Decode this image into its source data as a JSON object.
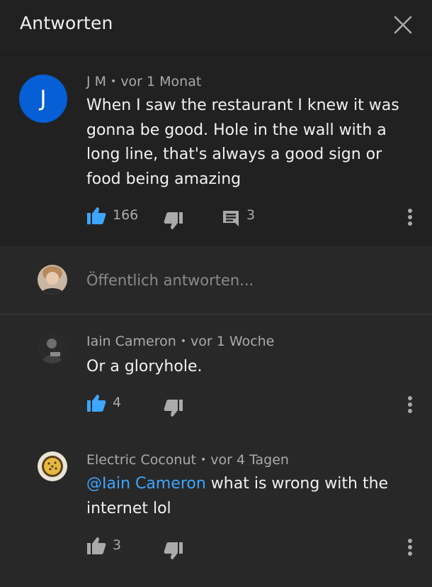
{
  "header": {
    "title": "Antworten",
    "close_icon": "close-icon"
  },
  "top_comment": {
    "avatar_letter": "J",
    "author": "J M",
    "time": "vor 1 Monat",
    "text": "When I saw the restaurant I knew it was gonna be good. Hole in the wall with a long line, that's always a good sign or food being amazing",
    "likes": "166",
    "replies": "3",
    "liked": true
  },
  "reply_box": {
    "placeholder": "Öffentlich antworten..."
  },
  "replies": [
    {
      "author": "Iain Cameron",
      "time": "vor 1 Woche",
      "text": "Or a gloryhole.",
      "likes": "4",
      "liked": true
    },
    {
      "author": "Electric Coconut",
      "time": "vor 4 Tagen",
      "mention": "@Iain Cameron",
      "text": " what is wrong with the internet lol",
      "likes": "3",
      "liked": false
    }
  ],
  "colors": {
    "accent": "#3ea6ff",
    "avatar_blue": "#065fd4",
    "background": "#282828",
    "header": "#212121"
  }
}
